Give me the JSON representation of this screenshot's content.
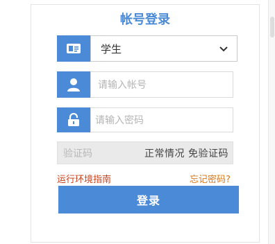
{
  "form": {
    "title": "帐号登录",
    "role": {
      "selected": "学生"
    },
    "username": {
      "placeholder": "请输入帐号"
    },
    "password": {
      "placeholder": "请输入密码"
    },
    "captcha": {
      "placeholder": "验证码",
      "status": "正常情况 免验证码"
    },
    "links": {
      "env_guide": "运行环境指南",
      "forgot_password": "忘记密码?"
    },
    "submit_label": "登录"
  },
  "colors": {
    "accent": "#4a8ad6",
    "link_env": "#c8401a",
    "link_forgot": "#d9781f"
  },
  "icons": {
    "role": "id-card-icon",
    "user": "user-icon",
    "password": "lock-icon",
    "dropdown": "chevron-down-icon"
  }
}
